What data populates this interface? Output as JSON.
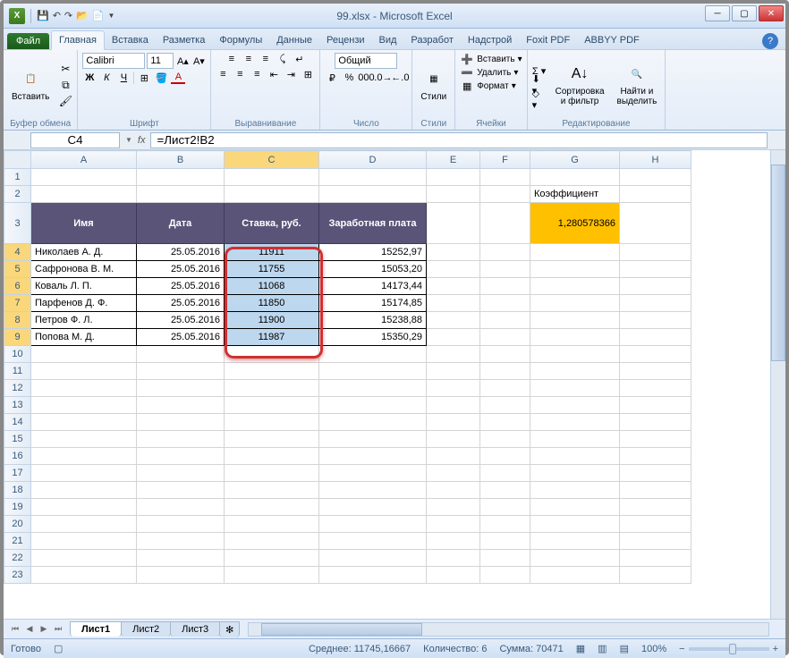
{
  "title": "99.xlsx - Microsoft Excel",
  "qat": {
    "save": "💾",
    "undo": "↶",
    "redo": "↷",
    "open": "📂",
    "new": "📄"
  },
  "tabs": {
    "file": "Файл",
    "home": "Главная",
    "insert": "Вставка",
    "layout": "Разметка",
    "formulas": "Формулы",
    "data": "Данные",
    "review": "Рецензи",
    "view": "Вид",
    "dev": "Разработ",
    "addin": "Надстрой",
    "foxit": "Foxit PDF",
    "abbyy": "ABBYY PDF"
  },
  "groups": {
    "clipboard": "Буфер обмена",
    "font": "Шрифт",
    "align": "Выравнивание",
    "number": "Число",
    "styles": "Стили",
    "cells": "Ячейки",
    "editing": "Редактирование",
    "paste": "Вставить",
    "styles_btn": "Стили",
    "ins": "Вставить",
    "del": "Удалить",
    "fmt": "Формат",
    "sort": "Сортировка\nи фильтр",
    "find": "Найти и\nвыделить"
  },
  "font": {
    "name": "Calibri",
    "size": "11",
    "bold": "Ж",
    "italic": "К",
    "underline": "Ч"
  },
  "numfmt": "Общий",
  "namebox": "C4",
  "formula": "=Лист2!B2",
  "cols": [
    "A",
    "B",
    "C",
    "D",
    "E",
    "F",
    "G",
    "H"
  ],
  "headers": {
    "a": "Имя",
    "b": "Дата",
    "c": "Ставка, руб.",
    "d": "Заработная плата"
  },
  "g2": "Коэффициент",
  "g3": "1,280578366",
  "rows": [
    {
      "a": "Николаев А. Д.",
      "b": "25.05.2016",
      "c": "11911",
      "d": "15252,97"
    },
    {
      "a": "Сафронова В. М.",
      "b": "25.05.2016",
      "c": "11755",
      "d": "15053,20"
    },
    {
      "a": "Коваль Л. П.",
      "b": "25.05.2016",
      "c": "11068",
      "d": "14173,44"
    },
    {
      "a": "Парфенов Д. Ф.",
      "b": "25.05.2016",
      "c": "11850",
      "d": "15174,85"
    },
    {
      "a": "Петров Ф. Л.",
      "b": "25.05.2016",
      "c": "11900",
      "d": "15238,88"
    },
    {
      "a": "Попова М. Д.",
      "b": "25.05.2016",
      "c": "11987",
      "d": "15350,29"
    }
  ],
  "sheets": {
    "s1": "Лист1",
    "s2": "Лист2",
    "s3": "Лист3"
  },
  "status": {
    "ready": "Готово",
    "avg_l": "Среднее:",
    "avg_v": "11745,16667",
    "cnt_l": "Количество:",
    "cnt_v": "6",
    "sum_l": "Сумма:",
    "sum_v": "70471",
    "zoom": "100%"
  }
}
